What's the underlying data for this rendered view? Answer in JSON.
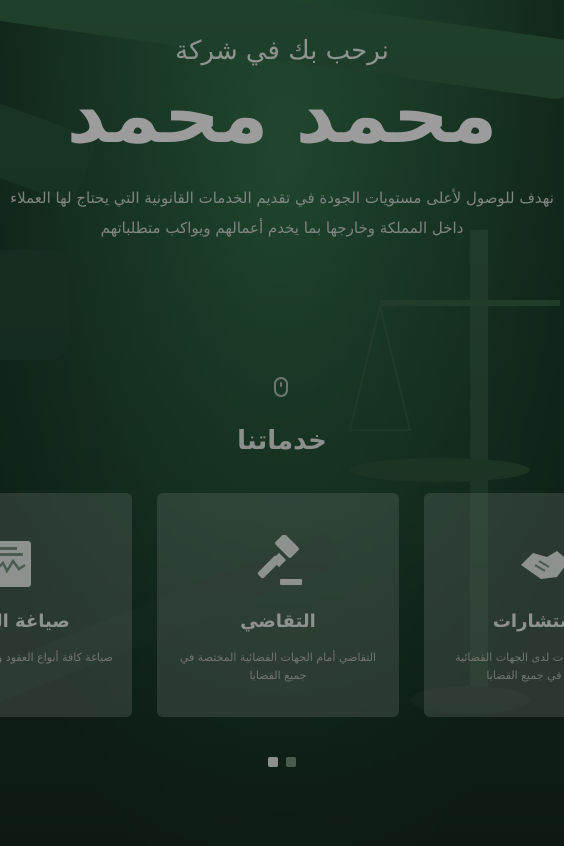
{
  "hero": {
    "welcome": "نرحب بك في شركة",
    "company_name": "محمد محمد",
    "tagline": "نهدف للوصول لأعلى مستويات الجودة في تقديم الخدمات القانونية التي يحتاج لها العملاء داخل المملكة وخارجها بما يخدم أعمالهم ويواكب متطلباتهم"
  },
  "scroll_indicator": {
    "icon": "mouse-icon"
  },
  "services": {
    "title": "خدماتنا",
    "cards": [
      {
        "title": "صياغة العقود",
        "description": "صياغة كافة أنواع العقود والوثائق والمستندات",
        "icon": "contract-icon"
      },
      {
        "title": "التقاضي",
        "description": "التقاضي أمام الجهات القضائية المختصة في جميع القضايا",
        "icon": "gavel-icon"
      },
      {
        "title": "الاستشارات",
        "description": "تقديم الاستشارات لدى الجهات القضائية المختصة في جميع القضايا",
        "icon": "handshake-icon"
      }
    ]
  },
  "carousel": {
    "page_count": 2,
    "active_page": 1
  },
  "colors": {
    "background": "#1a3a28",
    "text": "#9c9c9c",
    "card": "#5a645c"
  }
}
